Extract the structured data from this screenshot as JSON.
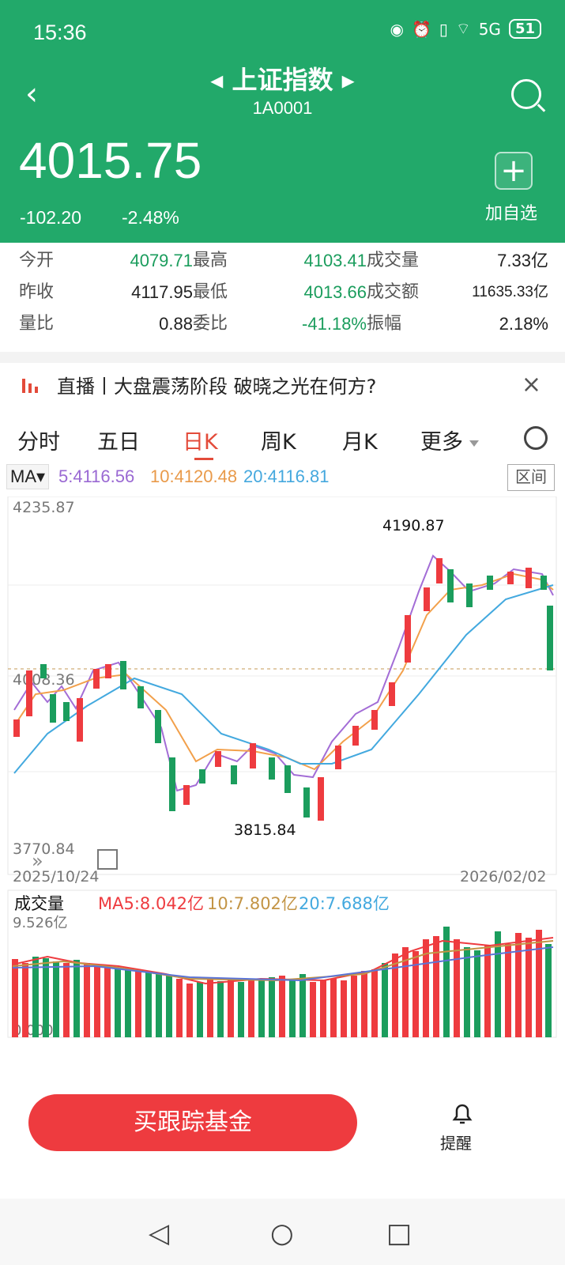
{
  "status": {
    "time": "15:36",
    "battery": "51",
    "network": "5G"
  },
  "header": {
    "title": "上证指数",
    "code": "1A0001",
    "price": "4015.75",
    "change": "-102.20",
    "change_pct": "-2.48%",
    "add_label": "加自选"
  },
  "stats": [
    [
      "今开",
      "4079.71",
      "最高",
      "4103.41",
      "成交量",
      "7.33亿"
    ],
    [
      "昨收",
      "4117.95",
      "最低",
      "4013.66",
      "成交额",
      "11635.33亿"
    ],
    [
      "量比",
      "0.88",
      "委比",
      "-41.18%",
      "振幅",
      "2.18%"
    ]
  ],
  "news": {
    "text": "直播丨大盘震荡阶段 破晓之光在何方?"
  },
  "tabs": [
    "分时",
    "五日",
    "日K",
    "周K",
    "月K",
    "更多"
  ],
  "ma": {
    "label": "MA",
    "ma5": "5:4116.56",
    "ma10": "10:4120.48",
    "ma20": "20:4116.81",
    "range": "区间"
  },
  "chart_data": {
    "type": "line",
    "max": "4235.87",
    "min": "3770.84",
    "mid": "4008.36",
    "high_label": "4190.87",
    "low_label": "3815.84",
    "start_date": "2025/10/24",
    "end_date": "2026/02/02",
    "volume_label": "成交量",
    "volume_max": "9.526亿",
    "volume_ma5": "MA5:8.042亿",
    "volume_ma10": "10:7.802亿",
    "volume_ma20": "20:7.688亿",
    "volume_zero": "0.000",
    "series": [
      {
        "name": "MA5",
        "color": "#a36dd6"
      },
      {
        "name": "MA10",
        "color": "#f2a04b"
      },
      {
        "name": "MA20",
        "color": "#43a9df"
      }
    ]
  },
  "bottom": {
    "buy": "买跟踪基金",
    "remind": "提醒"
  }
}
